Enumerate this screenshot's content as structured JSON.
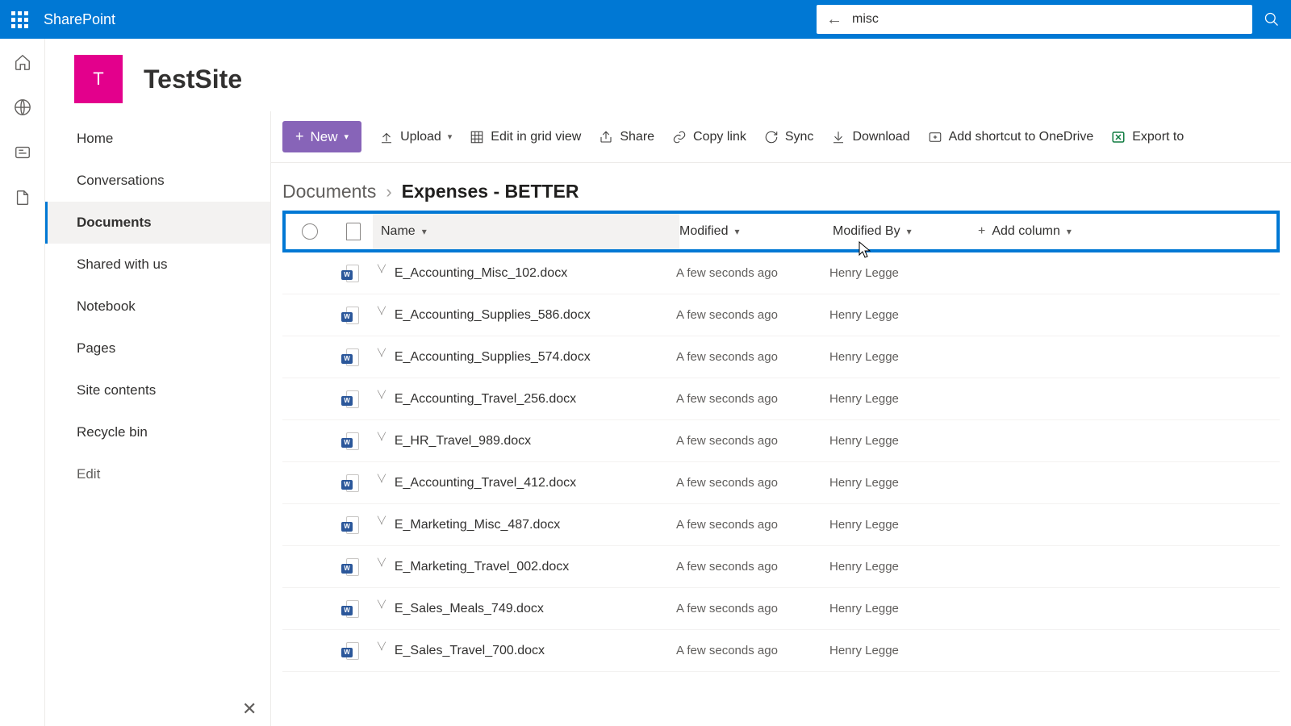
{
  "header": {
    "brand": "SharePoint",
    "search_value": "misc"
  },
  "site": {
    "logo_letter": "T",
    "title": "TestSite"
  },
  "nav": {
    "items": [
      {
        "label": "Home",
        "active": false
      },
      {
        "label": "Conversations",
        "active": false
      },
      {
        "label": "Documents",
        "active": true
      },
      {
        "label": "Shared with us",
        "active": false
      },
      {
        "label": "Notebook",
        "active": false
      },
      {
        "label": "Pages",
        "active": false
      },
      {
        "label": "Site contents",
        "active": false
      },
      {
        "label": "Recycle bin",
        "active": false
      },
      {
        "label": "Edit",
        "active": false,
        "muted": true
      }
    ]
  },
  "cmdbar": {
    "new": "New",
    "upload": "Upload",
    "grid": "Edit in grid view",
    "share": "Share",
    "copy": "Copy link",
    "sync": "Sync",
    "download": "Download",
    "shortcut": "Add shortcut to OneDrive",
    "export": "Export to"
  },
  "breadcrumb": {
    "root": "Documents",
    "current": "Expenses - BETTER"
  },
  "columns": {
    "name": "Name",
    "modified": "Modified",
    "modified_by": "Modified By",
    "add": "Add column"
  },
  "rows": [
    {
      "name": "E_Accounting_Misc_102.docx",
      "modified": "A few seconds ago",
      "by": "Henry Legge"
    },
    {
      "name": "E_Accounting_Supplies_586.docx",
      "modified": "A few seconds ago",
      "by": "Henry Legge"
    },
    {
      "name": "E_Accounting_Supplies_574.docx",
      "modified": "A few seconds ago",
      "by": "Henry Legge"
    },
    {
      "name": "E_Accounting_Travel_256.docx",
      "modified": "A few seconds ago",
      "by": "Henry Legge"
    },
    {
      "name": "E_HR_Travel_989.docx",
      "modified": "A few seconds ago",
      "by": "Henry Legge"
    },
    {
      "name": "E_Accounting_Travel_412.docx",
      "modified": "A few seconds ago",
      "by": "Henry Legge"
    },
    {
      "name": "E_Marketing_Misc_487.docx",
      "modified": "A few seconds ago",
      "by": "Henry Legge"
    },
    {
      "name": "E_Marketing_Travel_002.docx",
      "modified": "A few seconds ago",
      "by": "Henry Legge"
    },
    {
      "name": "E_Sales_Meals_749.docx",
      "modified": "A few seconds ago",
      "by": "Henry Legge"
    },
    {
      "name": "E_Sales_Travel_700.docx",
      "modified": "A few seconds ago",
      "by": "Henry Legge"
    }
  ]
}
